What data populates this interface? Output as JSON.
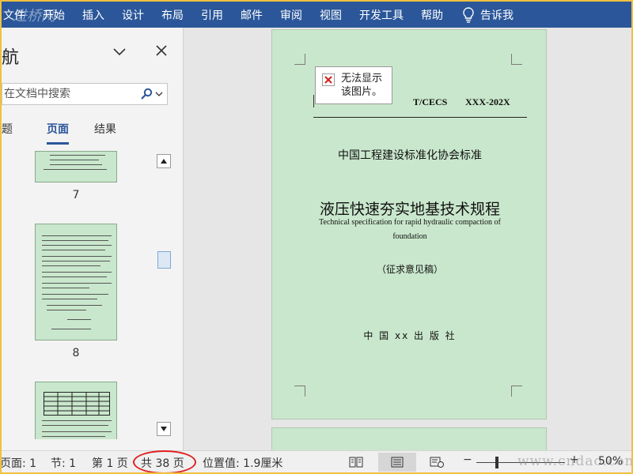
{
  "watermark_top": "进桥网",
  "watermark_bottom": "www.cndao.com",
  "menu": {
    "items": [
      "文件",
      "开始",
      "插入",
      "设计",
      "布局",
      "引用",
      "邮件",
      "审阅",
      "视图",
      "开发工具",
      "帮助"
    ],
    "tell_me": "告诉我"
  },
  "nav": {
    "title": "导航",
    "search_placeholder": "在文档中搜索",
    "tabs": {
      "headings": "标题",
      "pages": "页面",
      "results": "结果"
    },
    "thumb_labels": [
      "7",
      "8"
    ]
  },
  "document": {
    "broken_image_text_1": "无法显示",
    "broken_image_text_2": "该图片。",
    "std_code": "T/CECS",
    "std_number": "XXX-202X",
    "association": "中国工程建设标准化协会标准",
    "title_cn": "液压快速夯实地基技术规程",
    "title_en_1": "Technical specification for rapid hydraulic compaction of",
    "title_en_2": "foundation",
    "draft": "（征求意见稿）",
    "publisher": "中 国 xx 出 版 社"
  },
  "status": {
    "page": "页面: 1",
    "section": "节: 1",
    "page_of": "第 1 页",
    "total_pages": "共 38 页",
    "position": "位置值: 1.9厘米",
    "zoom": "50%"
  },
  "colors": {
    "ribbon": "#2b579a",
    "page_bg": "#c9e7cc",
    "highlight_circle": "#e02020"
  }
}
